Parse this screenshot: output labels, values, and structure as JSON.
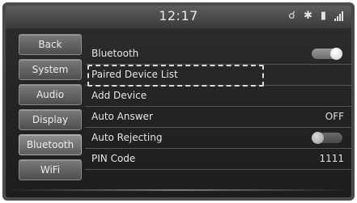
{
  "status": {
    "time": "12:17",
    "icons": [
      "usb-icon",
      "bluetooth-icon",
      "phone-battery-icon",
      "signal-strength-icon"
    ]
  },
  "sidebar": {
    "items": [
      {
        "label": "Back"
      },
      {
        "label": "System"
      },
      {
        "label": "Audio"
      },
      {
        "label": "Display"
      },
      {
        "label": "Bluetooth",
        "selected": true
      },
      {
        "label": "WiFi"
      }
    ]
  },
  "settings": {
    "rows": [
      {
        "label": "Bluetooth",
        "toggle": "on"
      },
      {
        "label": "Paired Device List",
        "focused": true
      },
      {
        "label": "Add Device"
      },
      {
        "label": "Auto Answer",
        "value": "OFF"
      },
      {
        "label": "Auto Rejecting",
        "toggle": "off"
      },
      {
        "label": "PIN Code",
        "value": "1111"
      }
    ]
  }
}
